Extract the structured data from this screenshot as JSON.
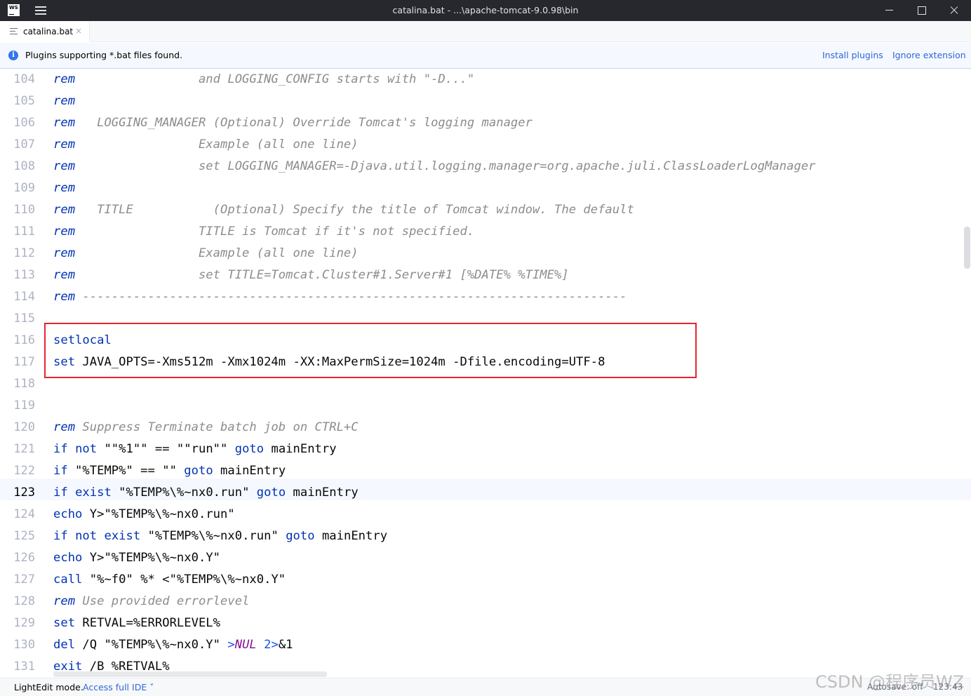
{
  "window": {
    "logo": "WS",
    "title": "catalina.bat - ...\\apache-tomcat-9.0.98\\bin"
  },
  "tab": {
    "label": "catalina.bat",
    "close": "×"
  },
  "banner": {
    "info_icon": "i",
    "message": "Plugins supporting *.bat files found.",
    "install_link": "Install plugins",
    "ignore_link": "Ignore extension"
  },
  "editor": {
    "current_line": "123",
    "lines": [
      {
        "n": "104",
        "t": "rem                 and LOGGING_CONFIG starts with \"-D...\""
      },
      {
        "n": "105",
        "t": "rem"
      },
      {
        "n": "106",
        "t": "rem   LOGGING_MANAGER (Optional) Override Tomcat's logging manager"
      },
      {
        "n": "107",
        "t": "rem                 Example (all one line)"
      },
      {
        "n": "108",
        "t": "rem                 set LOGGING_MANAGER=-Djava.util.logging.manager=org.apache.juli.ClassLoaderLogManager"
      },
      {
        "n": "109",
        "t": "rem"
      },
      {
        "n": "110",
        "t": "rem   TITLE           (Optional) Specify the title of Tomcat window. The default"
      },
      {
        "n": "111",
        "t": "rem                 TITLE is Tomcat if it's not specified."
      },
      {
        "n": "112",
        "t": "rem                 Example (all one line)"
      },
      {
        "n": "113",
        "t": "rem                 set TITLE=Tomcat.Cluster#1.Server#1 [%DATE% %TIME%]"
      },
      {
        "n": "114",
        "t": "rem ---------------------------------------------------------------------------"
      },
      {
        "n": "115",
        "t": ""
      },
      {
        "n": "116",
        "t": "setlocal"
      },
      {
        "n": "117",
        "t": "set JAVA_OPTS=-Xms512m -Xmx1024m -XX:MaxPermSize=1024m -Dfile.encoding=UTF-8"
      },
      {
        "n": "118",
        "t": ""
      },
      {
        "n": "119",
        "t": ""
      },
      {
        "n": "120",
        "t": "rem Suppress Terminate batch job on CTRL+C"
      },
      {
        "n": "121",
        "t": "if not \"\"%1\"\" == \"\"run\"\" goto mainEntry"
      },
      {
        "n": "122",
        "t": "if \"%TEMP%\" == \"\" goto mainEntry"
      },
      {
        "n": "123",
        "t": "if exist \"%TEMP%\\%~nx0.run\" goto mainEntry"
      },
      {
        "n": "124",
        "t": "echo Y>\"%TEMP%\\%~nx0.run\""
      },
      {
        "n": "125",
        "t": "if not exist \"%TEMP%\\%~nx0.run\" goto mainEntry"
      },
      {
        "n": "126",
        "t": "echo Y>\"%TEMP%\\%~nx0.Y\""
      },
      {
        "n": "127",
        "t": "call \"%~f0\" %* <\"%TEMP%\\%~nx0.Y\""
      },
      {
        "n": "128",
        "t": "rem Use provided errorlevel"
      },
      {
        "n": "129",
        "t": "set RETVAL=%ERRORLEVEL%"
      },
      {
        "n": "130",
        "t": "del /Q \"%TEMP%\\%~nx0.Y\" >NUL 2>&1"
      },
      {
        "n": "131",
        "t": "exit /B %RETVAL%"
      }
    ]
  },
  "status": {
    "mode": "LightEdit mode.",
    "access_link": "Access full IDE ˅",
    "autosave": "Autosave: off",
    "position": "123:43"
  },
  "watermark": "CSDN @程序员WZ",
  "colors": {
    "keyword": "#0033b3",
    "comment": "#8c8c8c",
    "string_ext": "#067d17",
    "highlight_box": "#e3262d",
    "titlebar": "#27282e"
  }
}
